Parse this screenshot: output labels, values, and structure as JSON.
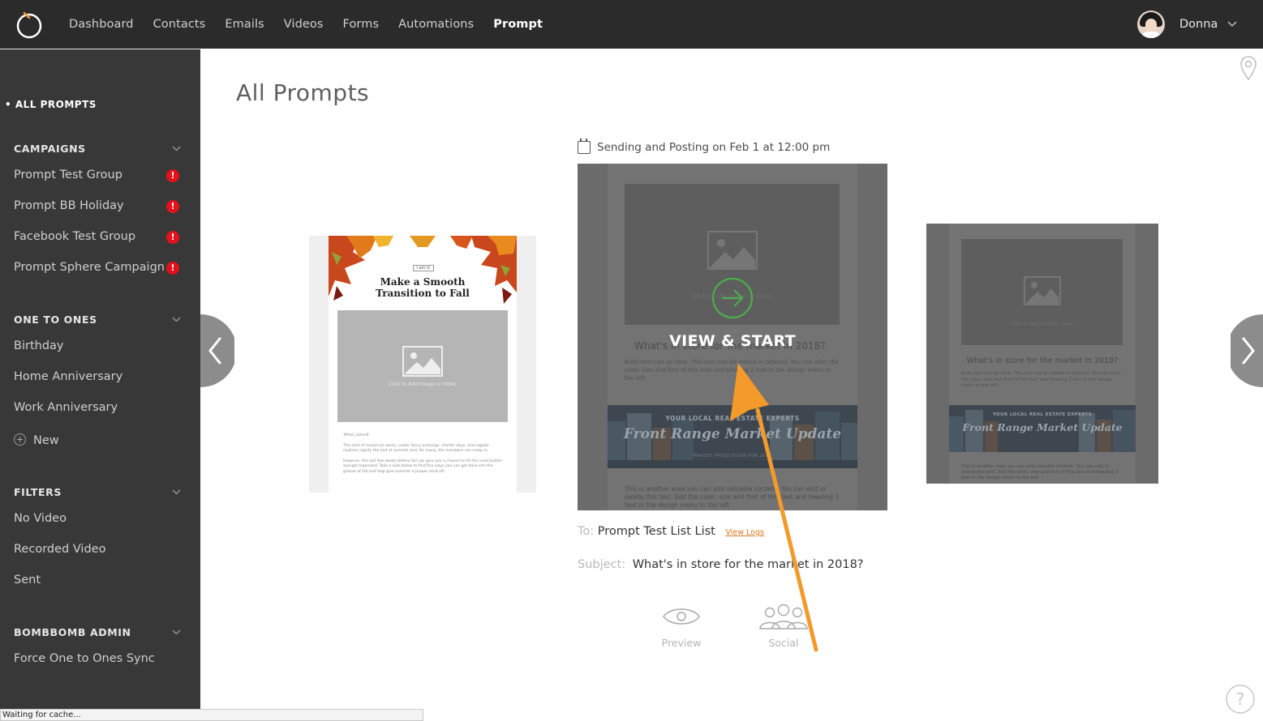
{
  "nav": {
    "items": [
      {
        "label": "Dashboard",
        "active": false
      },
      {
        "label": "Contacts",
        "active": false
      },
      {
        "label": "Emails",
        "active": false
      },
      {
        "label": "Videos",
        "active": false
      },
      {
        "label": "Forms",
        "active": false
      },
      {
        "label": "Automations",
        "active": false
      },
      {
        "label": "Prompt",
        "active": true
      }
    ],
    "user_name": "Donna"
  },
  "sidebar": {
    "all_prompts": "ALL PROMPTS",
    "campaigns_header": "CAMPAIGNS",
    "campaigns": [
      {
        "label": "Prompt Test Group",
        "badge": "!"
      },
      {
        "label": "Prompt BB Holiday",
        "badge": "!"
      },
      {
        "label": "Facebook Test Group",
        "badge": "!"
      },
      {
        "label": "Prompt Sphere Campaign",
        "badge": "!"
      }
    ],
    "one_to_ones_header": "ONE TO ONES",
    "one_to_ones": [
      {
        "label": "Birthday"
      },
      {
        "label": "Home Anniversary"
      },
      {
        "label": "Work Anniversary"
      }
    ],
    "new_label": "New",
    "filters_header": "FILTERS",
    "filters": [
      {
        "label": "No Video"
      },
      {
        "label": "Recorded Video"
      },
      {
        "label": "Sent"
      }
    ],
    "admin_header": "BOMBBOMB ADMIN",
    "admin": [
      {
        "label": "Force One to Ones Sync"
      }
    ]
  },
  "main": {
    "title": "All Prompts",
    "schedule": "Sending and Posting on Feb 1 at 12:00 pm",
    "left_card": {
      "tag": "I am in",
      "title_line1": "Make a Smooth",
      "title_line2": "Transition to Fall",
      "image_caption": "Click to Add Image or Video",
      "greeting": "#first_name#",
      "paragraph1": "The start of school (or work), cooler fancy evenings, shorter days, and regular routines signify the end of summer and, for many, the mundane can creep in.",
      "paragraph2": "However, the last few weeks before fall can give you a chance to hit the reset button and get organized. Take a look below to find five ways you can get back into the groove of fall and help give summer a proper send off."
    },
    "center_card": {
      "image_caption": "Click to Add Image or Video",
      "heading": "What's in store for the market in 2018?",
      "body": "Body text can go here. This text can be edited or deleted. You can alter the color, size and font of this text and heading 2 text in the design menu to the left.",
      "banner_sub": "YOUR LOCAL REAL ESTATE EXPERTS",
      "banner_title": "Front Range Market Update",
      "banner_sub2": "MARKET PROJECTIONS FOR 2018",
      "footer": "This is another area you can add valuable content. You can edit or delete this text. Edit the color, size and font of this text and heading 3 text in the design menu to the left.",
      "overlay_label": "VIEW & START"
    },
    "right_card": {
      "image_caption": "Click to Add Image or Video",
      "heading": "What's in store for the market in 2018?",
      "body": "Body text can go here. This text can be edited or deleted. You can alter the color, size and font of this text and heading 2 text in the design menu to the left.",
      "banner_sub": "YOUR LOCAL REAL ESTATE EXPERTS",
      "banner_title": "Front Range Market Update",
      "footer": "This is another area you can add valuable content. You can edit or delete this text. Edit the color, size and font of this text and heading 3 text in the design menu to the left."
    },
    "to_label": "To:",
    "to_value": "Prompt Test List List",
    "view_logs": "View Logs",
    "subject_label": "Subject:",
    "subject_value": "What's in store for the market in 2018?",
    "actions": {
      "preview": "Preview",
      "social": "Social"
    }
  },
  "status_bar": "Waiting for cache...",
  "colors": {
    "topbar": "#2b2b2b",
    "sidebar": "#383838",
    "badge": "#e4101a",
    "accent_orange": "#f39a2a",
    "play_green": "#4cae4c"
  },
  "icons": [
    "logo-icon",
    "chevron-down-icon",
    "calendar-icon",
    "chevron-left-icon",
    "chevron-right-icon",
    "image-icon",
    "play-arrow-icon",
    "eye-icon",
    "people-icon",
    "map-pin-icon",
    "help-icon",
    "plus-circle-icon"
  ]
}
